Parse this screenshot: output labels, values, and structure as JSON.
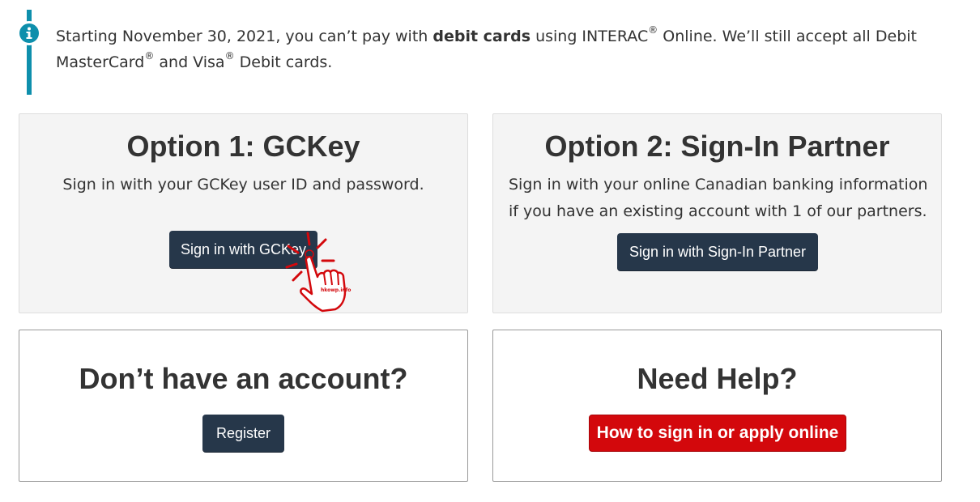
{
  "notice": {
    "icon": "info-icon",
    "accent_color": "#0e8fac",
    "text_start": "Starting November 30, 2021, you can’t pay with ",
    "text_bold": "debit cards",
    "text_mid1": " using INTERAC",
    "reg1": "®",
    "text_mid2": " Online. We’ll still accept all Debit MasterCard",
    "reg2": "®",
    "text_mid3": " and Visa",
    "reg3": "®",
    "text_end": " Debit cards."
  },
  "option1": {
    "title": "Option 1: GCKey",
    "description": "Sign in with your GCKey user ID and password.",
    "button_label": "Sign in with GCKey"
  },
  "option2": {
    "title": "Option 2: Sign-In Partner",
    "description": "Sign in with your online Canadian banking information if you have an existing account with 1 of our partners.",
    "button_label": "Sign in with Sign-In Partner"
  },
  "no_account": {
    "title": "Don’t have an account?",
    "button_label": "Register"
  },
  "need_help": {
    "title": "Need Help?",
    "button_label": "How to sign in or apply online"
  },
  "cursor": {
    "icon": "hand-pointer-click-icon",
    "watermark": "hkowp.info",
    "color": "#d3080c"
  },
  "colors": {
    "dark_button": "#26374a",
    "red_button": "#d3080c",
    "panel_grey": "#f4f4f4"
  }
}
